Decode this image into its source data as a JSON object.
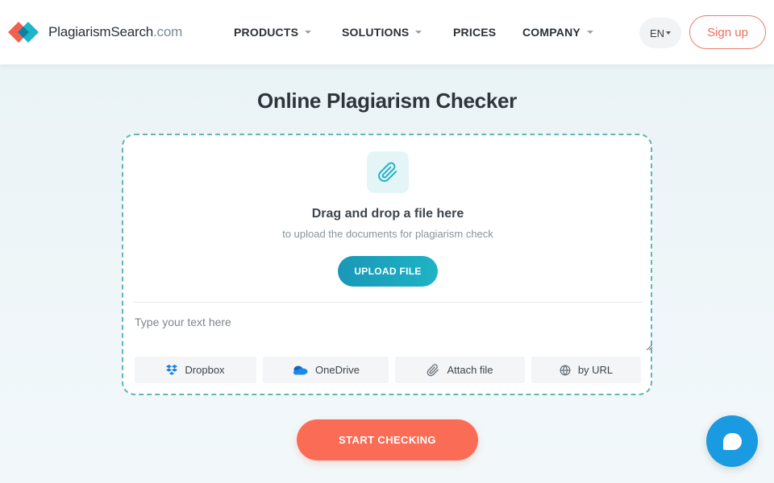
{
  "header": {
    "logo": {
      "name": "PlagiarismSearch",
      "domain": ".com",
      "icon": "logo-mark-icon"
    },
    "nav": [
      {
        "label": "PRODUCTS",
        "has_dropdown": true
      },
      {
        "label": "SOLUTIONS",
        "has_dropdown": true
      },
      {
        "label": "PRICES",
        "has_dropdown": false
      },
      {
        "label": "COMPANY",
        "has_dropdown": true
      }
    ],
    "language": "EN",
    "signup_label": "Sign up"
  },
  "main": {
    "title": "Online Plagiarism Checker",
    "dropzone": {
      "icon": "paperclip-icon",
      "heading": "Drag and drop a file here",
      "subheading": "to upload the documents for plagiarism check",
      "upload_label": "UPLOAD FILE"
    },
    "text_input": {
      "placeholder": "Type your text here",
      "value": ""
    },
    "sources": [
      {
        "label": "Dropbox",
        "icon": "dropbox-icon"
      },
      {
        "label": "OneDrive",
        "icon": "onedrive-icon"
      },
      {
        "label": "Attach file",
        "icon": "paperclip-icon"
      },
      {
        "label": "by URL",
        "icon": "globe-icon"
      }
    ],
    "start_label": "START CHECKING"
  },
  "colors": {
    "accent_coral": "#fb6c56",
    "accent_teal": "#1a97b8",
    "dashed_border": "#5fb8b2",
    "chat_blue": "#1a9ae0"
  }
}
